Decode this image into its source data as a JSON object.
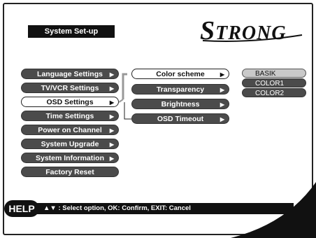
{
  "header": {
    "title": "System Set-up"
  },
  "brand": {
    "logo_text": "STRONG",
    "logo_first": "S",
    "logo_rest": "TRONG"
  },
  "main_menu": {
    "items": [
      {
        "label": "Language Settings",
        "arrow": "▶",
        "selected": false
      },
      {
        "label": "TV/VCR Settings",
        "arrow": "▶",
        "selected": false
      },
      {
        "label": "OSD Settings",
        "arrow": "▶",
        "selected": true
      },
      {
        "label": "Time Settings",
        "arrow": "▶",
        "selected": false
      },
      {
        "label": "Power on Channel",
        "arrow": "▶",
        "selected": false
      },
      {
        "label": "System Upgrade",
        "arrow": "▶",
        "selected": false
      },
      {
        "label": "System Information",
        "arrow": "▶",
        "selected": false
      },
      {
        "label": "Factory Reset",
        "arrow": "",
        "selected": false
      }
    ]
  },
  "osd_submenu": {
    "items": [
      {
        "label": "Color scheme",
        "arrow": "▶",
        "selected": true
      },
      {
        "label": "Transparency",
        "arrow": "▶",
        "selected": false
      },
      {
        "label": "Brightness",
        "arrow": "▶",
        "selected": false
      },
      {
        "label": "OSD Timeout",
        "arrow": "▶",
        "selected": false
      }
    ]
  },
  "color_scheme_options": {
    "items": [
      {
        "label": "BASIK",
        "highlighted": true
      },
      {
        "label": "COLOR1",
        "highlighted": false
      },
      {
        "label": "COLOR2",
        "highlighted": false
      }
    ]
  },
  "help": {
    "badge": "HELP",
    "text": "▲▼ : Select option, OK: Confirm, EXIT: Cancel"
  },
  "colors": {
    "pill_dark": "#4b4b4b",
    "highlight": "#c9c9c9",
    "bar": "#111111"
  }
}
